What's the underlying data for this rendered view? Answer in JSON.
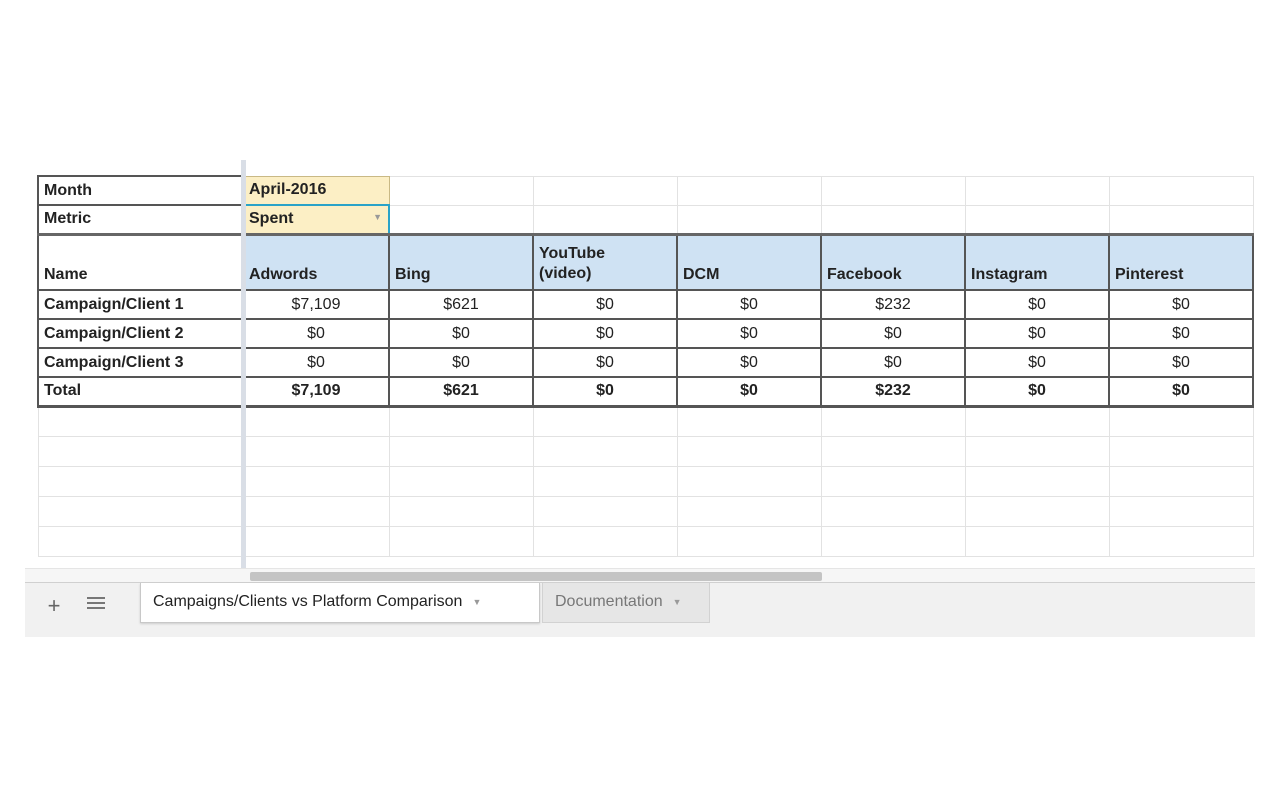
{
  "controls": {
    "month_label": "Month",
    "month_value": "April-2016",
    "metric_label": "Metric",
    "metric_value": "Spent"
  },
  "table": {
    "headers": [
      "Name",
      "Adwords",
      "Bing",
      "YouTube (video)",
      "DCM",
      "Facebook",
      "Instagram",
      "Pinterest"
    ],
    "youtube_line1": "YouTube",
    "youtube_line2": "(video)",
    "rows": [
      {
        "name": "Campaign/Client 1",
        "values": [
          "$7,109",
          "$621",
          "$0",
          "$0",
          "$232",
          "$0",
          "$0"
        ]
      },
      {
        "name": "Campaign/Client 2",
        "values": [
          "$0",
          "$0",
          "$0",
          "$0",
          "$0",
          "$0",
          "$0"
        ]
      },
      {
        "name": "Campaign/Client 3",
        "values": [
          "$0",
          "$0",
          "$0",
          "$0",
          "$0",
          "$0",
          "$0"
        ]
      }
    ],
    "total": {
      "name": "Total",
      "values": [
        "$7,109",
        "$621",
        "$0",
        "$0",
        "$232",
        "$0",
        "$0"
      ]
    }
  },
  "tabbar": {
    "add_icon": "plus-icon",
    "list_icon": "menu-list-icon",
    "tabs": [
      {
        "label": "Campaigns/Clients vs Platform Comparison",
        "active": true
      },
      {
        "label": "Documentation",
        "active": false
      }
    ]
  },
  "colors": {
    "header_fill": "#cfe2f3",
    "input_fill": "#fcefc5",
    "selected_border": "#2aa3c8"
  }
}
